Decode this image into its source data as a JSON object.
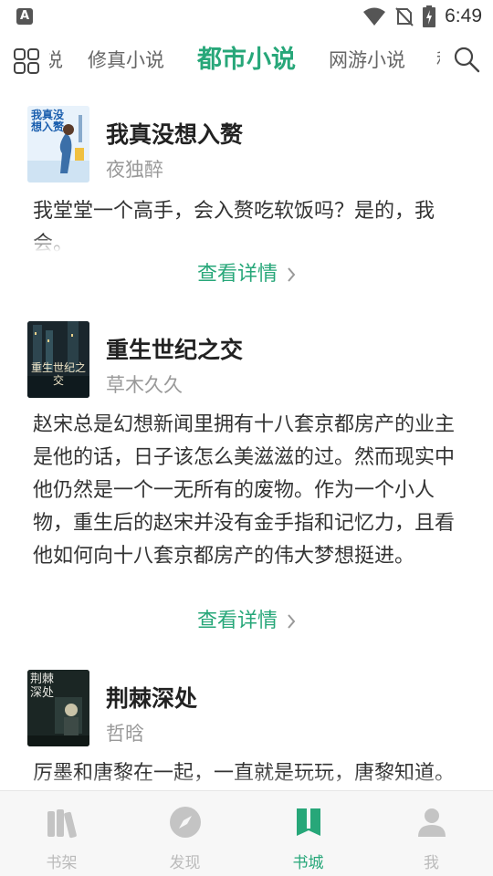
{
  "status_bar": {
    "time": "6:49",
    "notification_icon": "A",
    "icons": [
      "wifi-icon",
      "no-sim-icon",
      "battery-charging-icon"
    ]
  },
  "top_nav": {
    "tabs": [
      {
        "label": "修真小说",
        "active": false
      },
      {
        "label": "都市小说",
        "active": true
      },
      {
        "label": "网游小说",
        "active": false
      }
    ],
    "partial_left_glyph": "说",
    "partial_right_glyph": "科"
  },
  "books": [
    {
      "title": "我真没想入赘",
      "author": "夜独醉",
      "description": "我堂堂一个高手，会入赘吃软饭吗？是的，我会。",
      "detail_label": "查看详情"
    },
    {
      "title": "重生世纪之交",
      "author": "草木久久",
      "description": "赵宋总是幻想新闻里拥有十八套京都房产的业主是他的话，日子该怎么美滋滋的过。然而现实中他仍然是一个一无所有的废物。作为一个小人物，重生后的赵宋并没有金手指和记忆力，且看他如何向十八套京都房产的伟大梦想挺进。",
      "detail_label": "查看详情",
      "cover_text": "重生世纪之交"
    },
    {
      "title": "荆棘深处",
      "author": "哲晗",
      "description": "厉墨和唐黎在一起，一直就是玩玩，唐黎知道。",
      "cover_text": "荆棘深处"
    }
  ],
  "book1_cover_text": "我真没想入赘",
  "bottom_nav": [
    {
      "label": "书架",
      "icon": "bookshelf-icon",
      "active": false
    },
    {
      "label": "发现",
      "icon": "compass-icon",
      "active": false
    },
    {
      "label": "书城",
      "icon": "book-store-icon",
      "active": true
    },
    {
      "label": "我",
      "icon": "user-icon",
      "active": false
    }
  ],
  "colors": {
    "accent": "#27a779",
    "inactive": "#bbbbbb",
    "muted": "#999999"
  }
}
